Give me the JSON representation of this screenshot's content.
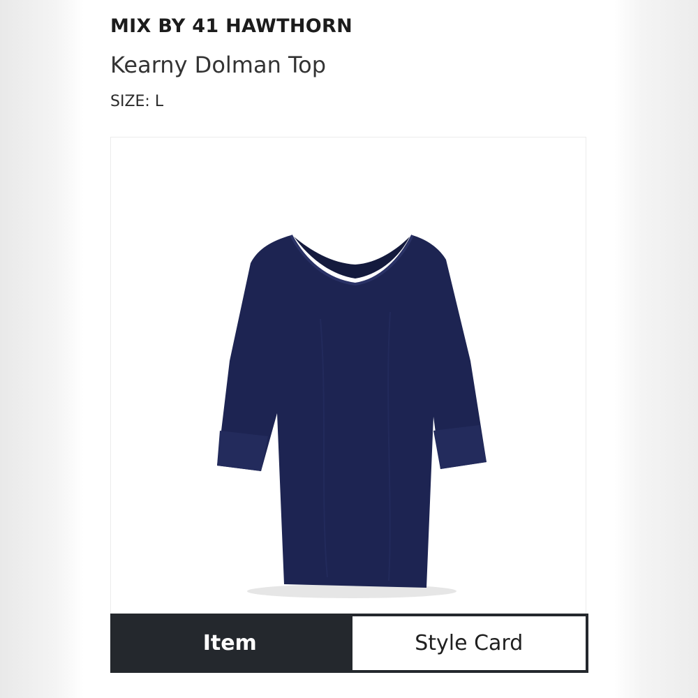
{
  "product": {
    "brand": "MIX BY 41 HAWTHORN",
    "name": "Kearny Dolman Top",
    "size_label": "SIZE:",
    "size_value": "L",
    "color": "#1d2452"
  },
  "tabs": [
    {
      "label": "Item",
      "active": true
    },
    {
      "label": "Style Card",
      "active": false
    }
  ],
  "colors": {
    "active_tab_bg": "#24282d",
    "garment": "#1d2452"
  }
}
